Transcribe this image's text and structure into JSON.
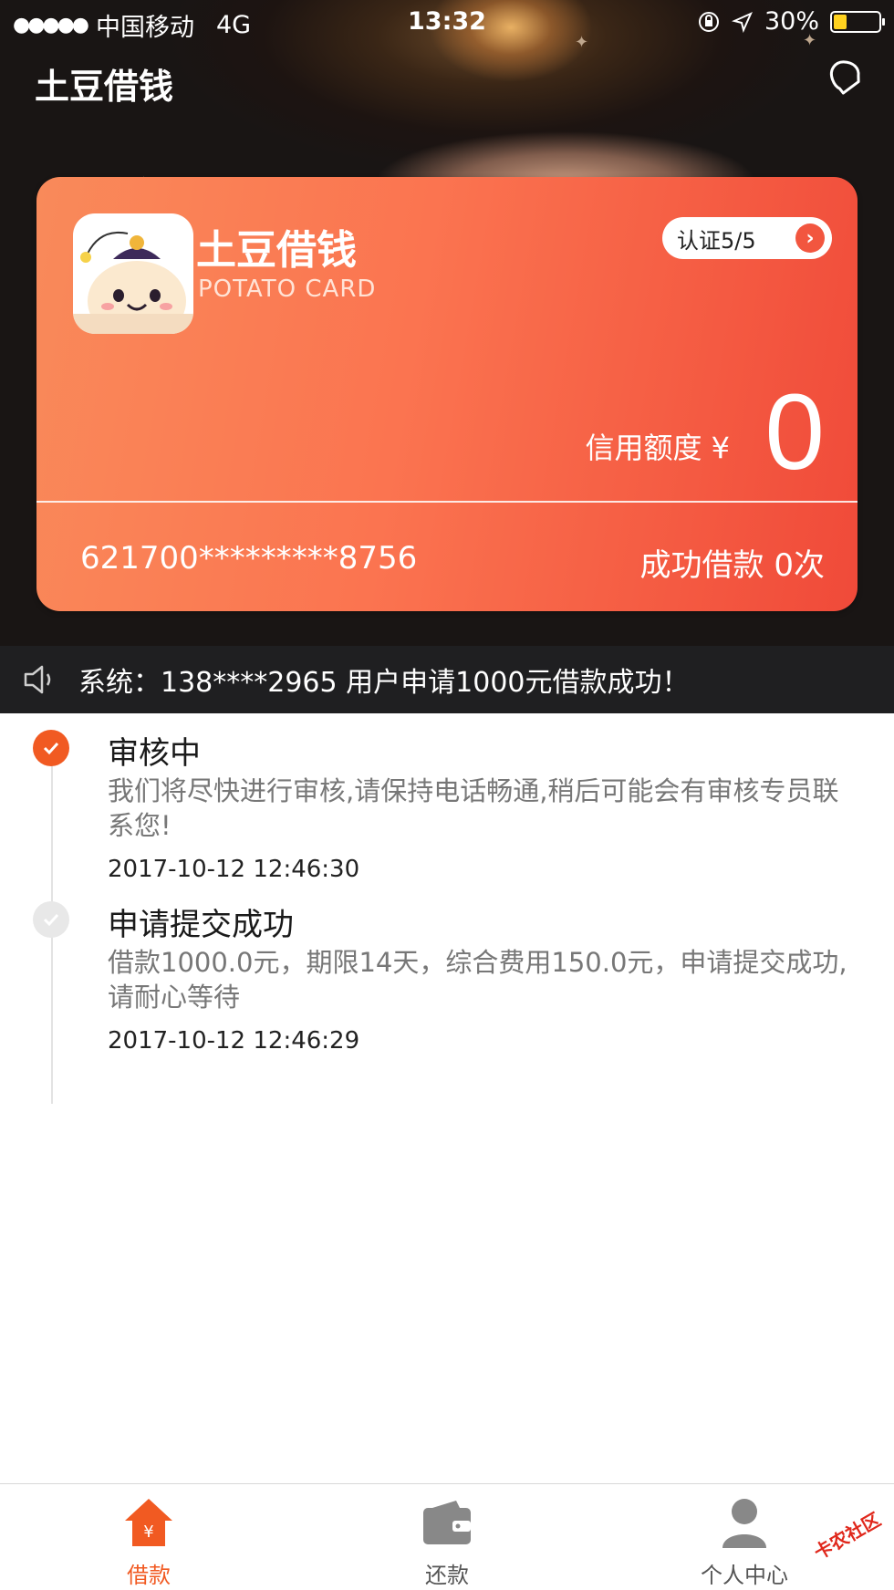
{
  "status_bar": {
    "signal": "●●●●●",
    "carrier": "中国移动",
    "network": "4G",
    "time": "13:32",
    "battery": "30%",
    "battery_level": 0.3
  },
  "header": {
    "title": "土豆借钱"
  },
  "card": {
    "name": "土豆借钱",
    "subtitle": "POTATO CARD",
    "verify_label": "认证5/5",
    "credit_label": "信用额度 ¥",
    "credit_value": "0",
    "card_number": "621700*********8756",
    "loan_count": "成功借款 0次"
  },
  "notice": {
    "text": "系统：138****2965 用户申请1000元借款成功！"
  },
  "timeline": [
    {
      "title": "审核中",
      "desc": "我们将尽快进行审核,请保持电话畅通,稍后可能会有审核专员联系您!",
      "time": "2017-10-12 12:46:30",
      "state": "active"
    },
    {
      "title": "申请提交成功",
      "desc": "借款1000.0元，期限14天，综合费用150.0元，申请提交成功,请耐心等待",
      "time": "2017-10-12 12:46:29",
      "state": "done"
    }
  ],
  "tabs": [
    {
      "label": "借款",
      "icon": "home-yuan-icon",
      "active": true
    },
    {
      "label": "还款",
      "icon": "wallet-icon",
      "active": false
    },
    {
      "label": "个人中心",
      "icon": "user-icon",
      "active": false
    }
  ],
  "watermark": "卡农社区",
  "colors": {
    "accent": "#f15a22",
    "card_start": "#f98a5a",
    "card_end": "#f04a39"
  }
}
